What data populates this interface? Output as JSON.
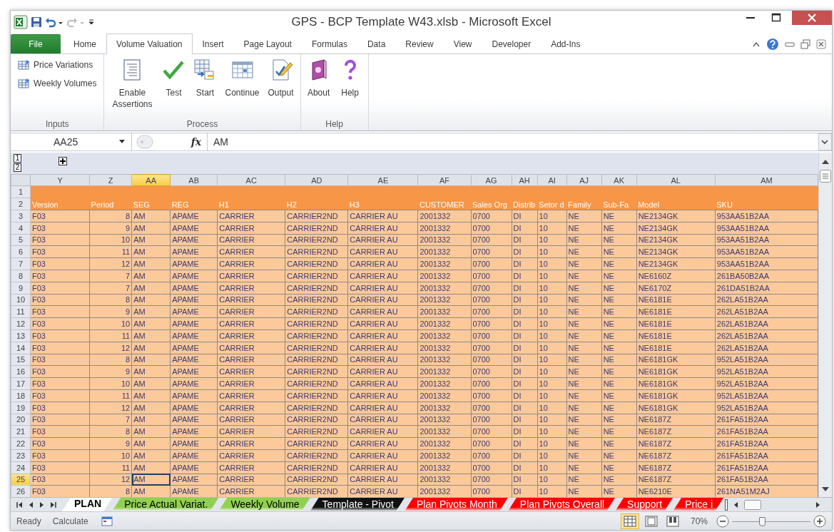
{
  "window": {
    "title": "GPS - BCP Template W43.xlsb - Microsoft Excel"
  },
  "ribbon_tabs": [
    {
      "label": "File",
      "kind": "file",
      "selected": false
    },
    {
      "label": "Home",
      "kind": "tab",
      "selected": false
    },
    {
      "label": "Volume Valuation",
      "kind": "tab",
      "selected": true
    },
    {
      "label": "Insert",
      "kind": "tab",
      "selected": false
    },
    {
      "label": "Page Layout",
      "kind": "tab",
      "selected": false
    },
    {
      "label": "Formulas",
      "kind": "tab",
      "selected": false
    },
    {
      "label": "Data",
      "kind": "tab",
      "selected": false
    },
    {
      "label": "Review",
      "kind": "tab",
      "selected": false
    },
    {
      "label": "View",
      "kind": "tab",
      "selected": false
    },
    {
      "label": "Developer",
      "kind": "tab",
      "selected": false
    },
    {
      "label": "Add-Ins",
      "kind": "tab",
      "selected": false
    }
  ],
  "ribbon_groups": [
    {
      "label": "Inputs",
      "commands": [
        {
          "label": "Price Variations",
          "kind": "small"
        },
        {
          "label": "Weekly Volumes",
          "kind": "small"
        }
      ]
    },
    {
      "label": "Process",
      "commands": [
        {
          "label": "Enable Assertions",
          "kind": "large"
        },
        {
          "label": "Test",
          "kind": "large"
        },
        {
          "label": "Start",
          "kind": "large"
        },
        {
          "label": "Continue",
          "kind": "large"
        },
        {
          "label": "Output",
          "kind": "large"
        }
      ]
    },
    {
      "label": "Help",
      "commands": [
        {
          "label": "About",
          "kind": "large"
        },
        {
          "label": "Help",
          "kind": "large"
        }
      ]
    }
  ],
  "formula_bar": {
    "name_box": "AA25",
    "fx_label": "fx",
    "formula": "AM"
  },
  "outline_levels": [
    "1",
    "2"
  ],
  "columns": [
    {
      "label": "Y",
      "selected": false
    },
    {
      "label": "Z",
      "selected": false,
      "numeric": true
    },
    {
      "label": "AA",
      "selected": true
    },
    {
      "label": "AB",
      "selected": false
    },
    {
      "label": "AC",
      "selected": false
    },
    {
      "label": "AD",
      "selected": false
    },
    {
      "label": "AE",
      "selected": false
    },
    {
      "label": "AF",
      "selected": false
    },
    {
      "label": "AG",
      "selected": false
    },
    {
      "label": "AH",
      "selected": false
    },
    {
      "label": "AI",
      "selected": false
    },
    {
      "label": "AJ",
      "selected": false
    },
    {
      "label": "AK",
      "selected": false
    },
    {
      "label": "AL",
      "selected": false
    },
    {
      "label": "AM",
      "selected": false
    }
  ],
  "header_rows": [
    {
      "number": "1",
      "cells": []
    },
    {
      "number": "2",
      "cells": [
        "Version",
        "Period",
        "SEG",
        "REG",
        "H1",
        "H2",
        "H3",
        "CUSTOMER",
        "Sales Org",
        "Distrib",
        "Setor d",
        "Family",
        "Sub-Fa",
        "Model",
        "SKU"
      ]
    }
  ],
  "rows": [
    {
      "number": "3",
      "selected": false,
      "cells": [
        "F03",
        "8",
        "AM",
        "APAME",
        "CARRIER",
        "CARRIER2ND",
        "CARRIER AU",
        "2001332",
        "0700",
        "DI",
        "10",
        "NE",
        "NE",
        "NE2134GK",
        "953AA51B2AA"
      ]
    },
    {
      "number": "4",
      "selected": false,
      "cells": [
        "F03",
        "9",
        "AM",
        "APAME",
        "CARRIER",
        "CARRIER2ND",
        "CARRIER AU",
        "2001332",
        "0700",
        "DI",
        "10",
        "NE",
        "NE",
        "NE2134GK",
        "953AA51B2AA"
      ]
    },
    {
      "number": "5",
      "selected": false,
      "cells": [
        "F03",
        "10",
        "AM",
        "APAME",
        "CARRIER",
        "CARRIER2ND",
        "CARRIER AU",
        "2001332",
        "0700",
        "DI",
        "10",
        "NE",
        "NE",
        "NE2134GK",
        "953AA51B2AA"
      ]
    },
    {
      "number": "6",
      "selected": false,
      "cells": [
        "F03",
        "11",
        "AM",
        "APAME",
        "CARRIER",
        "CARRIER2ND",
        "CARRIER AU",
        "2001332",
        "0700",
        "DI",
        "10",
        "NE",
        "NE",
        "NE2134GK",
        "953AA51B2AA"
      ]
    },
    {
      "number": "7",
      "selected": false,
      "cells": [
        "F03",
        "12",
        "AM",
        "APAME",
        "CARRIER",
        "CARRIER2ND",
        "CARRIER AU",
        "2001332",
        "0700",
        "DI",
        "10",
        "NE",
        "NE",
        "NE2134GK",
        "953AA51B2AA"
      ]
    },
    {
      "number": "8",
      "selected": false,
      "cells": [
        "F03",
        "7",
        "AM",
        "APAME",
        "CARRIER",
        "CARRIER2ND",
        "CARRIER AU",
        "2001332",
        "0700",
        "DI",
        "10",
        "NE",
        "NE",
        "NE6160Z",
        "261BA50B2AA"
      ]
    },
    {
      "number": "9",
      "selected": false,
      "cells": [
        "F03",
        "7",
        "AM",
        "APAME",
        "CARRIER",
        "CARRIER2ND",
        "CARRIER AU",
        "2001332",
        "0700",
        "DI",
        "10",
        "NE",
        "NE",
        "NE6170Z",
        "261DA51B2AA"
      ]
    },
    {
      "number": "10",
      "selected": false,
      "cells": [
        "F03",
        "8",
        "AM",
        "APAME",
        "CARRIER",
        "CARRIER2ND",
        "CARRIER AU",
        "2001332",
        "0700",
        "DI",
        "10",
        "NE",
        "NE",
        "NE6181E",
        "262LA51B2AA"
      ]
    },
    {
      "number": "11",
      "selected": false,
      "cells": [
        "F03",
        "9",
        "AM",
        "APAME",
        "CARRIER",
        "CARRIER2ND",
        "CARRIER AU",
        "2001332",
        "0700",
        "DI",
        "10",
        "NE",
        "NE",
        "NE6181E",
        "262LA51B2AA"
      ]
    },
    {
      "number": "12",
      "selected": false,
      "cells": [
        "F03",
        "10",
        "AM",
        "APAME",
        "CARRIER",
        "CARRIER2ND",
        "CARRIER AU",
        "2001332",
        "0700",
        "DI",
        "10",
        "NE",
        "NE",
        "NE6181E",
        "262LA51B2AA"
      ]
    },
    {
      "number": "13",
      "selected": false,
      "cells": [
        "F03",
        "11",
        "AM",
        "APAME",
        "CARRIER",
        "CARRIER2ND",
        "CARRIER AU",
        "2001332",
        "0700",
        "DI",
        "10",
        "NE",
        "NE",
        "NE6181E",
        "262LA51B2AA"
      ]
    },
    {
      "number": "14",
      "selected": false,
      "cells": [
        "F03",
        "12",
        "AM",
        "APAME",
        "CARRIER",
        "CARRIER2ND",
        "CARRIER AU",
        "2001332",
        "0700",
        "DI",
        "10",
        "NE",
        "NE",
        "NE6181E",
        "262LA51B2AA"
      ]
    },
    {
      "number": "15",
      "selected": false,
      "cells": [
        "F03",
        "8",
        "AM",
        "APAME",
        "CARRIER",
        "CARRIER2ND",
        "CARRIER AU",
        "2001332",
        "0700",
        "DI",
        "10",
        "NE",
        "NE",
        "NE6181GK",
        "952LA51B2AA"
      ]
    },
    {
      "number": "16",
      "selected": false,
      "cells": [
        "F03",
        "9",
        "AM",
        "APAME",
        "CARRIER",
        "CARRIER2ND",
        "CARRIER AU",
        "2001332",
        "0700",
        "DI",
        "10",
        "NE",
        "NE",
        "NE6181GK",
        "952LA51B2AA"
      ]
    },
    {
      "number": "17",
      "selected": false,
      "cells": [
        "F03",
        "10",
        "AM",
        "APAME",
        "CARRIER",
        "CARRIER2ND",
        "CARRIER AU",
        "2001332",
        "0700",
        "DI",
        "10",
        "NE",
        "NE",
        "NE6181GK",
        "952LA51B2AA"
      ]
    },
    {
      "number": "18",
      "selected": false,
      "cells": [
        "F03",
        "11",
        "AM",
        "APAME",
        "CARRIER",
        "CARRIER2ND",
        "CARRIER AU",
        "2001332",
        "0700",
        "DI",
        "10",
        "NE",
        "NE",
        "NE6181GK",
        "952LA51B2AA"
      ]
    },
    {
      "number": "19",
      "selected": false,
      "cells": [
        "F03",
        "12",
        "AM",
        "APAME",
        "CARRIER",
        "CARRIER2ND",
        "CARRIER AU",
        "2001332",
        "0700",
        "DI",
        "10",
        "NE",
        "NE",
        "NE6181GK",
        "952LA51B2AA"
      ]
    },
    {
      "number": "20",
      "selected": false,
      "cells": [
        "F03",
        "7",
        "AM",
        "APAME",
        "CARRIER",
        "CARRIER2ND",
        "CARRIER AU",
        "2001332",
        "0700",
        "DI",
        "10",
        "NE",
        "NE",
        "NE6187Z",
        "261FA51B2AA"
      ]
    },
    {
      "number": "21",
      "selected": false,
      "cells": [
        "F03",
        "8",
        "AM",
        "APAME",
        "CARRIER",
        "CARRIER2ND",
        "CARRIER AU",
        "2001332",
        "0700",
        "DI",
        "10",
        "NE",
        "NE",
        "NE6187Z",
        "261FA51B2AA"
      ]
    },
    {
      "number": "22",
      "selected": false,
      "cells": [
        "F03",
        "9",
        "AM",
        "APAME",
        "CARRIER",
        "CARRIER2ND",
        "CARRIER AU",
        "2001332",
        "0700",
        "DI",
        "10",
        "NE",
        "NE",
        "NE6187Z",
        "261FA51B2AA"
      ]
    },
    {
      "number": "23",
      "selected": false,
      "cells": [
        "F03",
        "10",
        "AM",
        "APAME",
        "CARRIER",
        "CARRIER2ND",
        "CARRIER AU",
        "2001332",
        "0700",
        "DI",
        "10",
        "NE",
        "NE",
        "NE6187Z",
        "261FA51B2AA"
      ]
    },
    {
      "number": "24",
      "selected": false,
      "cells": [
        "F03",
        "11",
        "AM",
        "APAME",
        "CARRIER",
        "CARRIER2ND",
        "CARRIER AU",
        "2001332",
        "0700",
        "DI",
        "10",
        "NE",
        "NE",
        "NE6187Z",
        "261FA51B2AA"
      ]
    },
    {
      "number": "25",
      "selected": true,
      "cells": [
        "F03",
        "12",
        "AM",
        "APAME",
        "CARRIER",
        "CARRIER2ND",
        "CARRIER AU",
        "2001332",
        "0700",
        "DI",
        "10",
        "NE",
        "NE",
        "NE6187Z",
        "261FA51B2AA"
      ]
    },
    {
      "number": "26",
      "selected": false,
      "cells": [
        "F03",
        "8",
        "AM",
        "APAME",
        "CARRIER",
        "CARRIER2ND",
        "CARRIER AU",
        "2001332",
        "0700",
        "DI",
        "10",
        "NE",
        "NE",
        "NE6210E",
        "261NA51M2AJ"
      ]
    }
  ],
  "sheet_tabs": [
    {
      "label": "PLAN",
      "selected": true,
      "color": "#ffffff"
    },
    {
      "label": "Price Actual Variat.",
      "selected": false,
      "color": "#92d050"
    },
    {
      "label": "Weekly Volume",
      "selected": false,
      "color": "#92d050"
    },
    {
      "label": "Template - Pivot",
      "selected": false,
      "color": "#111111"
    },
    {
      "label": "Plan Pivots Month",
      "selected": false,
      "color": "#ff0000"
    },
    {
      "label": "Plan Pivots Overall",
      "selected": false,
      "color": "#ff0000"
    },
    {
      "label": "Support",
      "selected": false,
      "color": "#ff0000"
    },
    {
      "label": "Price i",
      "selected": false,
      "color": "#ff0000"
    }
  ],
  "status_bar": {
    "items": [
      "Ready",
      "Calculate"
    ],
    "views": [
      {
        "kind": "normal",
        "selected": true
      },
      {
        "kind": "page_layout",
        "selected": false
      },
      {
        "kind": "page_break",
        "selected": false
      }
    ],
    "zoom": "70%",
    "zoom_level": {
      "level": 0.38
    }
  }
}
